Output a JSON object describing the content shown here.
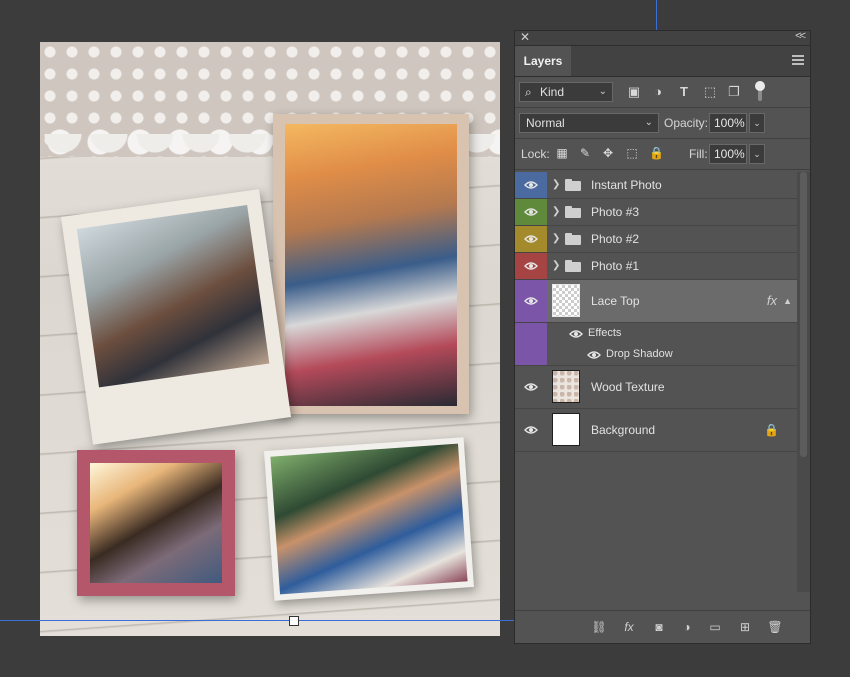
{
  "panel": {
    "close_icon": "close-icon",
    "collapse_label": "<<",
    "tab_title": "Layers",
    "filter": {
      "kind_label": "Kind",
      "icons": [
        "pixel-filter-icon",
        "adjustment-filter-icon",
        "type-filter-icon",
        "shape-filter-icon",
        "smart-object-filter-icon"
      ]
    },
    "blend_mode": "Normal",
    "opacity_label": "Opacity:",
    "opacity_value": "100%",
    "lock_label": "Lock:",
    "fill_label": "Fill:",
    "fill_value": "100%"
  },
  "layers": [
    {
      "name": "Instant Photo",
      "type": "group",
      "color": "#4a6aa0"
    },
    {
      "name": "Photo #3",
      "type": "group",
      "color": "#5f8a3c"
    },
    {
      "name": "Photo #2",
      "type": "group",
      "color": "#a38a2a"
    },
    {
      "name": "Photo #1",
      "type": "group",
      "color": "#a64444"
    },
    {
      "name": "Lace Top",
      "type": "layer",
      "color": "#7a55a8",
      "fx": "fx",
      "selected": true,
      "effects_label": "Effects",
      "effect_items": [
        "Drop Shadow"
      ]
    },
    {
      "name": "Wood Texture",
      "type": "layer"
    },
    {
      "name": "Background",
      "type": "layer",
      "locked": true
    }
  ],
  "bottom_icons": [
    "link-icon",
    "fx-icon",
    "mask-icon",
    "adjustment-icon",
    "new-group-icon",
    "new-layer-icon",
    "trash-icon"
  ],
  "bottom_fx_label": "fx"
}
